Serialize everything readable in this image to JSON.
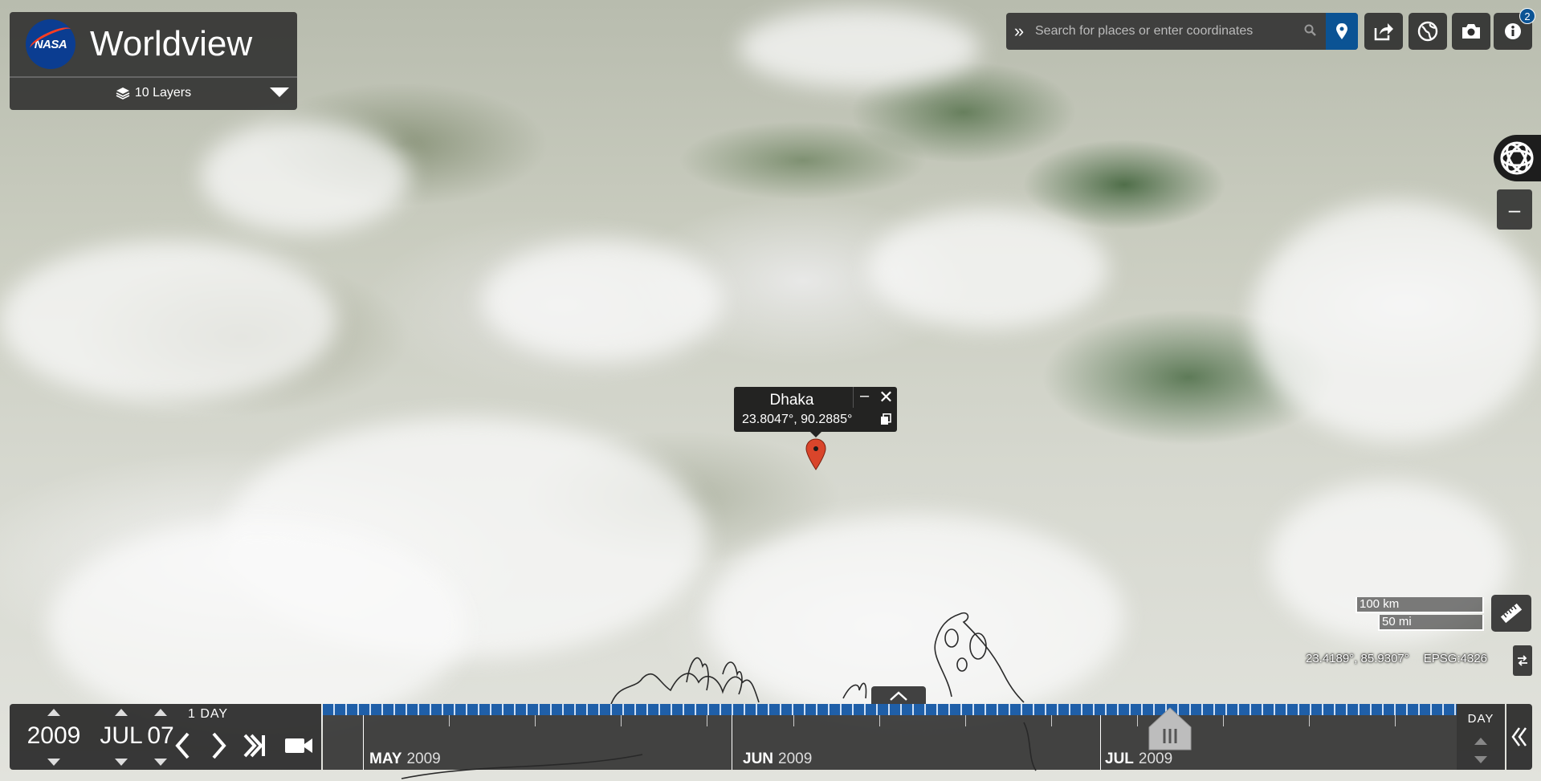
{
  "app": {
    "title": "Worldview",
    "logo_text": "NASA"
  },
  "layers": {
    "label": "10 Layers"
  },
  "search": {
    "placeholder": "Search for places or enter coordinates"
  },
  "info": {
    "badge_count": "2"
  },
  "popup": {
    "title": "Dhaka",
    "coords": "23.8047°, 90.2885°"
  },
  "scale": {
    "km": "100 km",
    "mi": "50 mi"
  },
  "coordinates": {
    "lat_lon": "23.4189°, 85.9307°",
    "projection": "EPSG:4326"
  },
  "date": {
    "year": "2009",
    "month": "JUL",
    "day": "07",
    "interval": "1  DAY"
  },
  "timeline": {
    "zoom_level": "DAY",
    "months": [
      {
        "name": "MAY",
        "year": "2009"
      },
      {
        "name": "JUN",
        "year": "2009"
      },
      {
        "name": "JUL",
        "year": "2009"
      }
    ]
  },
  "colors": {
    "accent": "#0b5394",
    "timeline_band": "#1f5fa8",
    "marker": "#d9452b"
  }
}
